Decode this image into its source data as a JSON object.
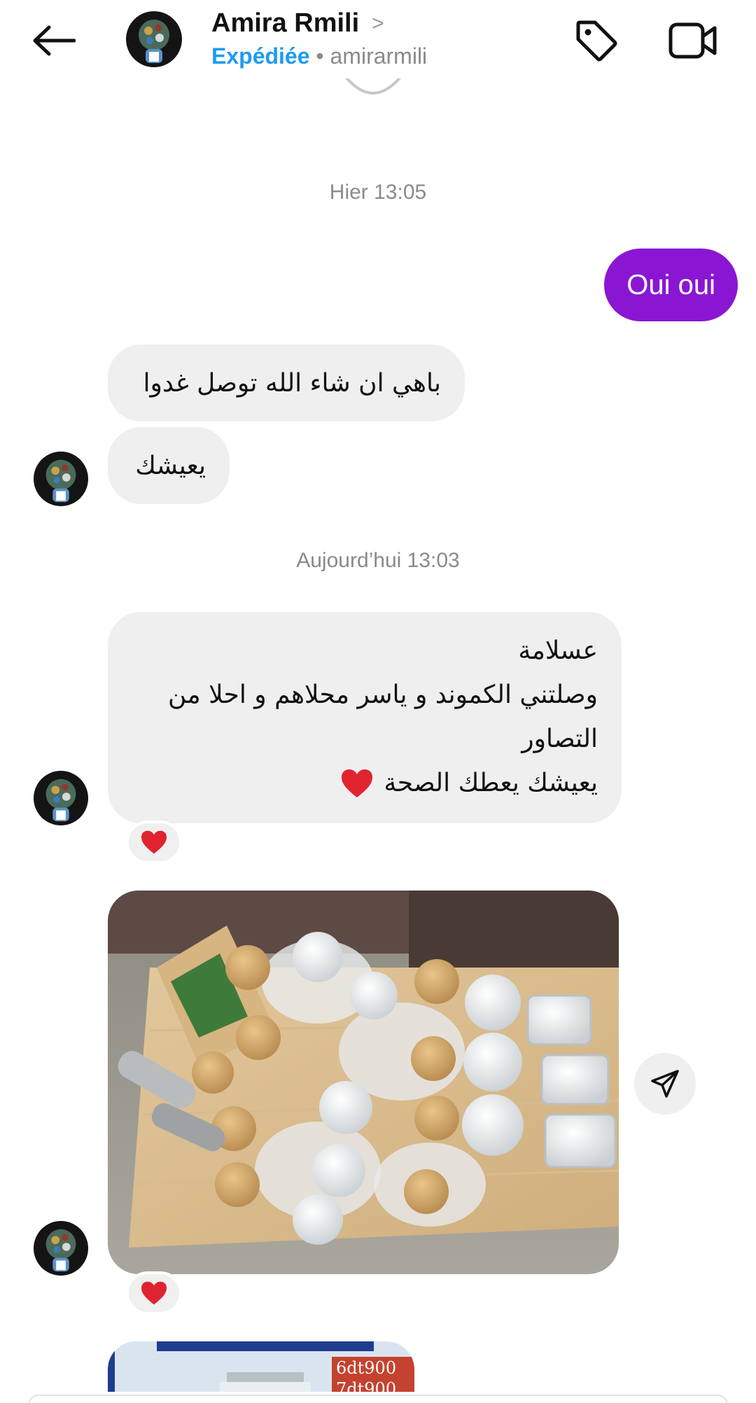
{
  "header": {
    "name": "Amira Rmili",
    "chevron": ">",
    "status": "Expédiée",
    "separator": " • ",
    "username": "amirarmili"
  },
  "timestamps": {
    "yesterday": "Hier 13:05",
    "today": "Aujourd’hui 13:03"
  },
  "messages": {
    "outgoing_1": "Oui oui",
    "incoming_1": "باهي ان شاء الله توصل غدوا",
    "incoming_2": "يعيشك",
    "incoming_3": {
      "line1": "عسلامة",
      "line2": "وصلتني الكموند و ياسر محلاهم و احلا من",
      "line3": "التصاور",
      "line4": "يعيشك يعطك الصحة"
    }
  },
  "reactions": {
    "message_3": "❤️",
    "photo_1": "❤️"
  },
  "photo2": {
    "price1": "6dt900",
    "price2": "7dt900"
  },
  "colors": {
    "outgoing_bubble": "#8a16d4",
    "incoming_bubble": "#efefef",
    "status_blue": "#1d9bf0",
    "heart_red": "#e0242f"
  },
  "icons": {
    "back": "arrow-left-icon",
    "tag": "tag-icon",
    "video": "video-call-icon",
    "share": "send-icon",
    "heart": "heart-icon"
  }
}
